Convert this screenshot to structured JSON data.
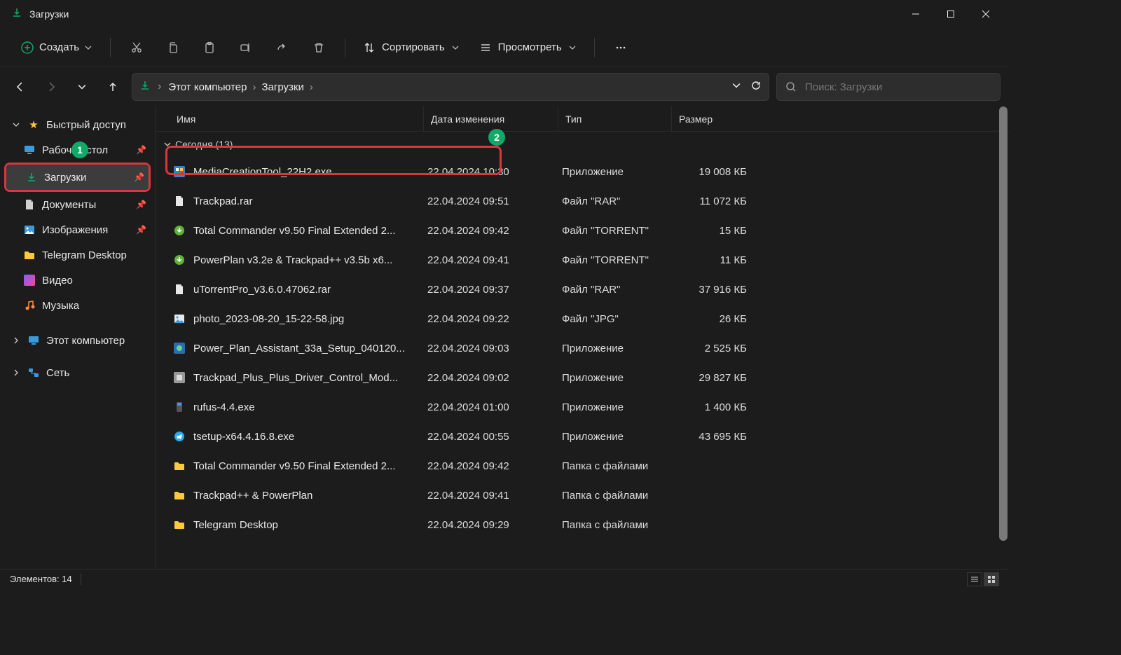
{
  "window": {
    "title": "Загрузки"
  },
  "toolbar": {
    "new_label": "Создать",
    "sort_label": "Сортировать",
    "view_label": "Просмотреть"
  },
  "breadcrumb": {
    "parts": [
      "Этот компьютер",
      "Загрузки"
    ]
  },
  "search": {
    "placeholder": "Поиск: Загрузки"
  },
  "sidebar": {
    "quick_access": "Быстрый доступ",
    "items": [
      {
        "label": "Рабочий стол",
        "icon": "monitor"
      },
      {
        "label": "Загрузки",
        "icon": "download"
      },
      {
        "label": "Документы",
        "icon": "doc"
      },
      {
        "label": "Изображения",
        "icon": "image"
      },
      {
        "label": "Telegram Desktop",
        "icon": "folder"
      },
      {
        "label": "Видео",
        "icon": "video"
      },
      {
        "label": "Музыка",
        "icon": "music"
      }
    ],
    "this_pc": "Этот компьютер",
    "network": "Сеть"
  },
  "columns": {
    "name": "Имя",
    "date": "Дата изменения",
    "type": "Тип",
    "size": "Размер"
  },
  "group": {
    "label": "Сегодня (13)"
  },
  "files": [
    {
      "name": "MediaCreationTool_22H2.exe",
      "date": "22.04.2024 10:30",
      "type": "Приложение",
      "size": "19 008 КБ",
      "icon": "exe-blue"
    },
    {
      "name": "Trackpad.rar",
      "date": "22.04.2024 09:51",
      "type": "Файл \"RAR\"",
      "size": "11 072 КБ",
      "icon": "file"
    },
    {
      "name": "Total Commander v9.50 Final Extended 2...",
      "date": "22.04.2024 09:42",
      "type": "Файл \"TORRENT\"",
      "size": "15 КБ",
      "icon": "torrent"
    },
    {
      "name": "PowerPlan v3.2e & Trackpad++ v3.5b x6...",
      "date": "22.04.2024 09:41",
      "type": "Файл \"TORRENT\"",
      "size": "11 КБ",
      "icon": "torrent"
    },
    {
      "name": "uTorrentPro_v3.6.0.47062.rar",
      "date": "22.04.2024 09:37",
      "type": "Файл \"RAR\"",
      "size": "37 916 КБ",
      "icon": "file"
    },
    {
      "name": "photo_2023-08-20_15-22-58.jpg",
      "date": "22.04.2024 09:22",
      "type": "Файл \"JPG\"",
      "size": "26 КБ",
      "icon": "image"
    },
    {
      "name": "Power_Plan_Assistant_33a_Setup_040120...",
      "date": "22.04.2024 09:03",
      "type": "Приложение",
      "size": "2 525 КБ",
      "icon": "exe-color"
    },
    {
      "name": "Trackpad_Plus_Plus_Driver_Control_Mod...",
      "date": "22.04.2024 09:02",
      "type": "Приложение",
      "size": "29 827 КБ",
      "icon": "exe-grey"
    },
    {
      "name": "rufus-4.4.exe",
      "date": "22.04.2024 01:00",
      "type": "Приложение",
      "size": "1 400 КБ",
      "icon": "exe-rufus"
    },
    {
      "name": "tsetup-x64.4.16.8.exe",
      "date": "22.04.2024 00:55",
      "type": "Приложение",
      "size": "43 695 КБ",
      "icon": "exe-tg"
    },
    {
      "name": "Total Commander v9.50 Final Extended 2...",
      "date": "22.04.2024 09:42",
      "type": "Папка с файлами",
      "size": "",
      "icon": "folder"
    },
    {
      "name": "Trackpad++ & PowerPlan",
      "date": "22.04.2024 09:41",
      "type": "Папка с файлами",
      "size": "",
      "icon": "folder"
    },
    {
      "name": "Telegram Desktop",
      "date": "22.04.2024 09:29",
      "type": "Папка с файлами",
      "size": "",
      "icon": "folder"
    }
  ],
  "status": {
    "items": "Элементов: 14"
  },
  "annotations": {
    "badge1": "1",
    "badge2": "2"
  }
}
